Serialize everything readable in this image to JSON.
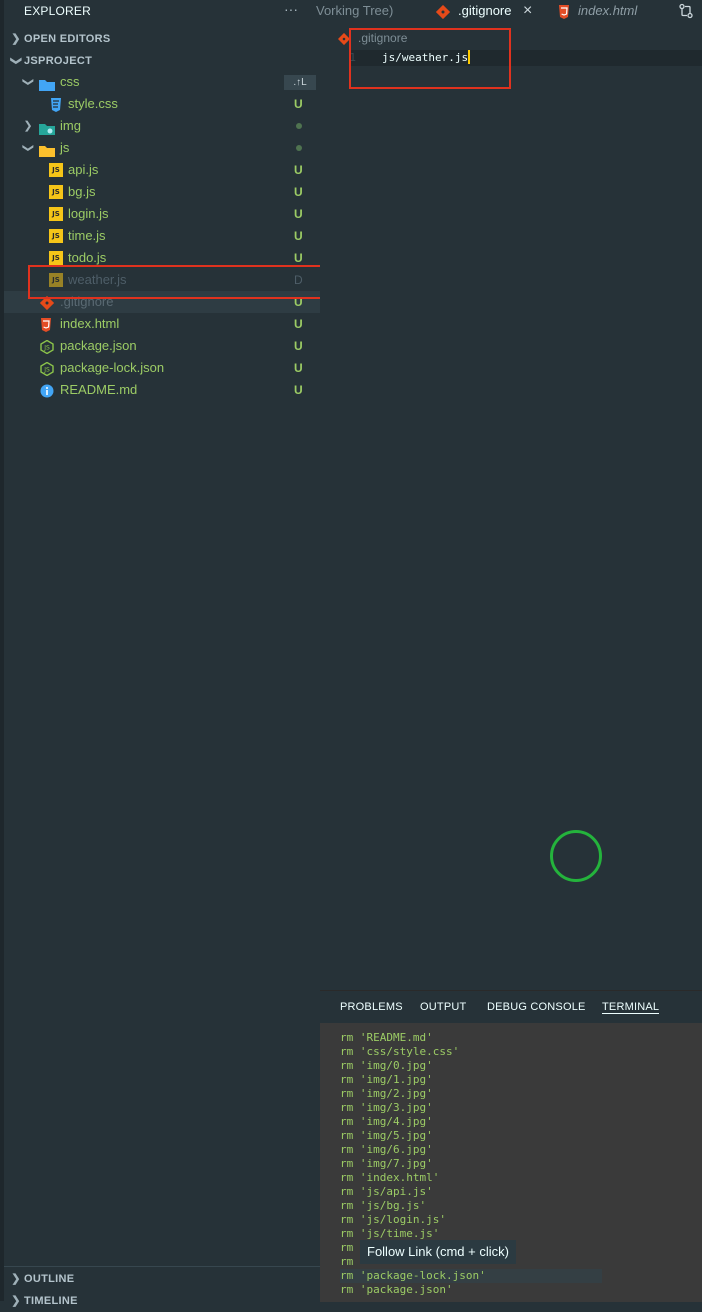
{
  "sidebar": {
    "title": "EXPLORER",
    "more": "···",
    "open_editors": "OPEN EDITORS",
    "project": "JSPROJECT",
    "outline": "OUTLINE",
    "timeline": "TIMELINE",
    "mini_action": ".↑L",
    "tree": {
      "css": {
        "label": "css"
      },
      "style_css": {
        "label": "style.css",
        "badge": "U"
      },
      "img": {
        "label": "img"
      },
      "js": {
        "label": "js"
      },
      "api": {
        "label": "api.js",
        "badge": "U"
      },
      "bg": {
        "label": "bg.js",
        "badge": "U"
      },
      "login": {
        "label": "login.js",
        "badge": "U"
      },
      "time": {
        "label": "time.js",
        "badge": "U"
      },
      "todo": {
        "label": "todo.js",
        "badge": "U"
      },
      "weather": {
        "label": "weather.js",
        "badge": "D"
      },
      "gitignore": {
        "label": ".gitignore",
        "badge": "U"
      },
      "index": {
        "label": "index.html",
        "badge": "U"
      },
      "package": {
        "label": "package.json",
        "badge": "U"
      },
      "package_lock": {
        "label": "package-lock.json",
        "badge": "U"
      },
      "readme": {
        "label": "README.md",
        "badge": "U"
      }
    }
  },
  "tabs": {
    "working_tree": "Vorking Tree)",
    "gitignore": ".gitignore",
    "index": "index.html",
    "close": "×"
  },
  "editor": {
    "breadcrumb": ".gitignore",
    "line_number": "1",
    "code": "js/weather.js"
  },
  "panel": {
    "tabs": [
      "PROBLEMS",
      "OUTPUT",
      "DEBUG CONSOLE",
      "TERMINAL"
    ],
    "lines": [
      "rm 'README.md'",
      "rm 'css/style.css'",
      "rm 'img/0.jpg'",
      "rm 'img/1.jpg'",
      "rm 'img/2.jpg'",
      "rm 'img/3.jpg'",
      "rm 'img/4.jpg'",
      "rm 'img/5.jpg'",
      "rm 'img/6.jpg'",
      "rm 'img/7.jpg'",
      "rm 'index.html'",
      "rm 'js/api.js'",
      "rm 'js/bg.js'",
      "rm 'js/login.js'",
      "rm 'js/time.js'",
      "rm",
      "rm",
      "rm 'package-lock.json'",
      "rm 'package.json'"
    ],
    "tooltip_link": "Follow Link",
    "tooltip_hint": " (cmd + click)"
  },
  "colors": {
    "accent_red": "#e0321e",
    "untracked": "#9ccc65",
    "background": "#263238"
  }
}
